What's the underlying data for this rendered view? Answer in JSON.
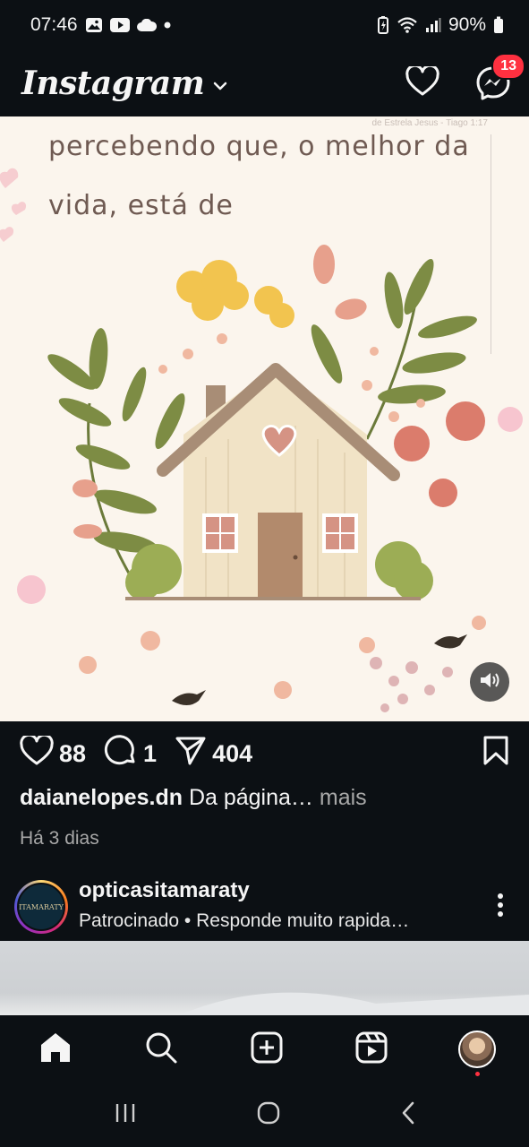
{
  "status_bar": {
    "time": "07:46",
    "battery": "90%"
  },
  "header": {
    "app_name": "Instagram",
    "message_badge": "13"
  },
  "post": {
    "text_line1": "percebendo que, o melhor da",
    "text_line2": "vida, está de",
    "watermark": "de Estrela Jesus - Tiago 1:17"
  },
  "actions": {
    "likes": "88",
    "comments": "1",
    "shares": "404"
  },
  "caption": {
    "username": "daianelopes.dn",
    "text": "Da página…",
    "more": "mais"
  },
  "timestamp": "Há 3 dias",
  "sponsored": {
    "account": "opticasitamaraty",
    "subtitle": "Patrocinado • Responde muito rapida…",
    "avatar_text": "ITAMARATY"
  },
  "colors": {
    "badge": "#ff3040",
    "background": "#0c1014",
    "post_bg": "#fbf5ed"
  },
  "icons": {
    "header": [
      "heart-icon",
      "messenger-icon"
    ],
    "actions": [
      "heart-icon",
      "comment-icon",
      "share-icon",
      "bookmark-icon"
    ],
    "nav": [
      "home-icon",
      "search-icon",
      "create-icon",
      "reels-icon",
      "profile-avatar"
    ],
    "system": [
      "recents-icon",
      "home-circle-icon",
      "back-icon"
    ]
  }
}
